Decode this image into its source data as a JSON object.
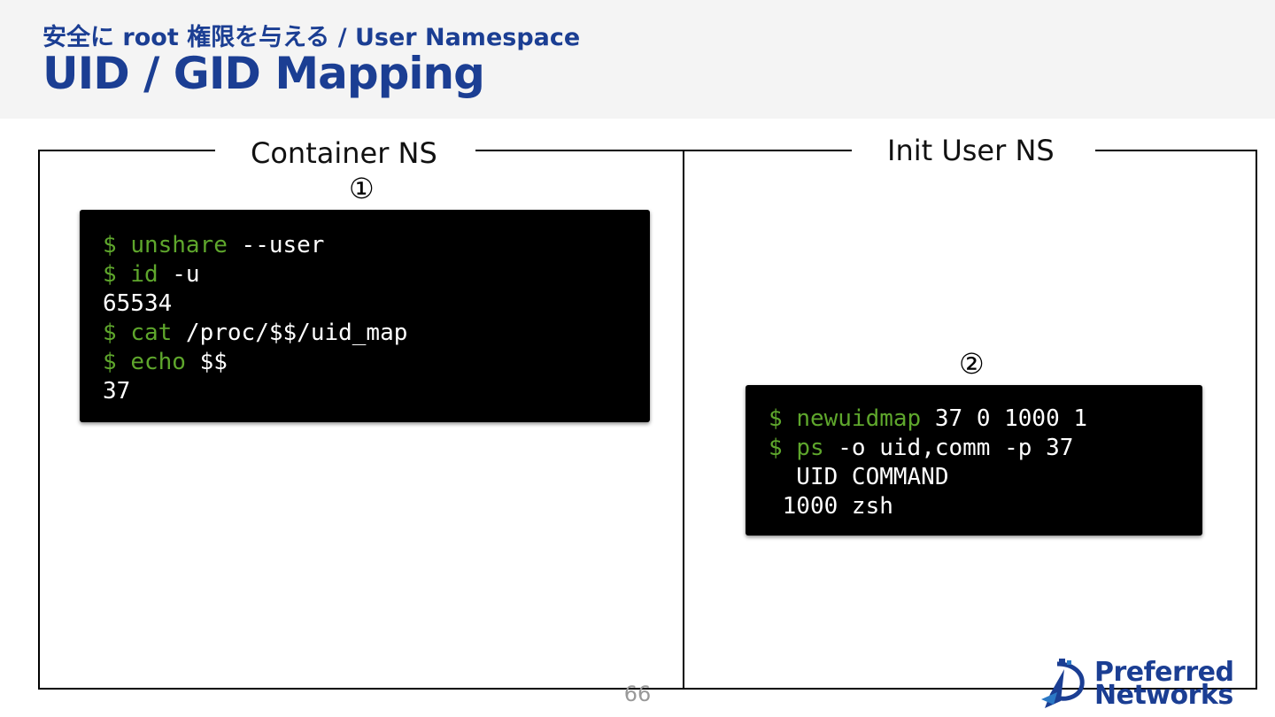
{
  "header": {
    "subtitle": "安全に root 権限を与える / User Namespace",
    "title": "UID / GID Mapping"
  },
  "container_ns": {
    "label": "Container NS",
    "step": "①",
    "terminal": [
      [
        {
          "t": "$ ",
          "c": "prompt"
        },
        {
          "t": "unshare",
          "c": "cmd"
        },
        {
          "t": " --user",
          "c": "arg"
        }
      ],
      [
        {
          "t": "$ ",
          "c": "prompt"
        },
        {
          "t": "id",
          "c": "cmd"
        },
        {
          "t": " -u",
          "c": "arg"
        }
      ],
      [
        {
          "t": "65534",
          "c": "out"
        }
      ],
      [
        {
          "t": "$ ",
          "c": "prompt"
        },
        {
          "t": "cat",
          "c": "cmd"
        },
        {
          "t": " /proc/$$/uid_map",
          "c": "arg"
        }
      ],
      [
        {
          "t": "$ ",
          "c": "prompt"
        },
        {
          "t": "echo",
          "c": "cmd"
        },
        {
          "t": " $$",
          "c": "arg"
        }
      ],
      [
        {
          "t": "37",
          "c": "out"
        }
      ]
    ]
  },
  "init_user_ns": {
    "label": "Init User NS",
    "step": "②",
    "terminal": [
      [
        {
          "t": "$ ",
          "c": "prompt"
        },
        {
          "t": "newuidmap",
          "c": "cmd"
        },
        {
          "t": " 37 0 1000 1",
          "c": "arg"
        }
      ],
      [
        {
          "t": "$ ",
          "c": "prompt"
        },
        {
          "t": "ps",
          "c": "cmd"
        },
        {
          "t": " -o uid,comm -p 37",
          "c": "arg"
        }
      ],
      [
        {
          "t": "  UID COMMAND",
          "c": "out"
        }
      ],
      [
        {
          "t": " 1000 zsh",
          "c": "out"
        }
      ]
    ]
  },
  "footer": {
    "page_number": "66",
    "logo_line1": "Preferred",
    "logo_line2": "Networks",
    "logo_icon": "pfn-logo-icon"
  },
  "colors": {
    "title": "#1b3e93",
    "prompt": "#5ea62c",
    "terminal_bg": "#000000",
    "terminal_text": "#ffffff"
  }
}
